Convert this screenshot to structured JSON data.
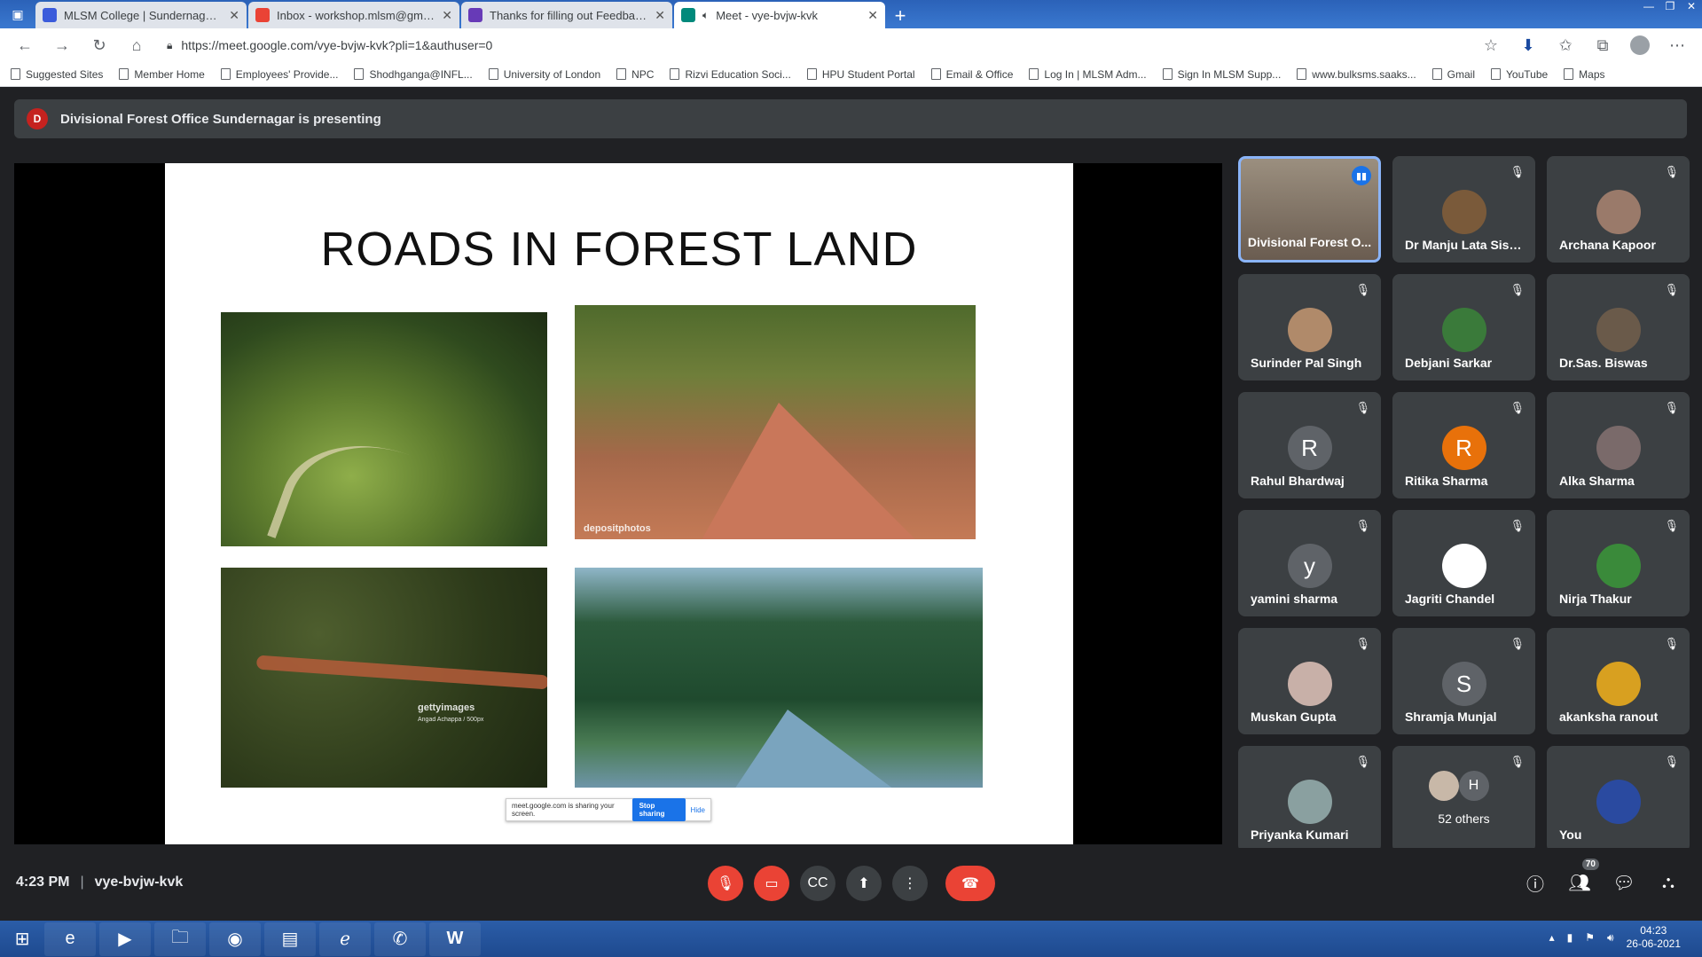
{
  "browser": {
    "tabs": [
      {
        "title": "MLSM College | Sundernagar, M",
        "favicon_color": "#3b5bdb"
      },
      {
        "title": "Inbox - workshop.mlsm@gmail.c",
        "favicon_color": "#ea4335"
      },
      {
        "title": "Thanks for filling out Feedback f",
        "favicon_color": "#673ab7"
      },
      {
        "title": "Meet - vye-bvjw-kvk",
        "favicon_color": "#00897b"
      }
    ],
    "url": "https://meet.google.com/vye-bvjw-kvk?pli=1&authuser=0",
    "bookmarks": [
      "Suggested Sites",
      "Member Home",
      "Employees' Provide...",
      "Shodhganga@INFL...",
      "University of London",
      "NPC",
      "Rizvi Education Soci...",
      "HPU Student Portal",
      "Email & Office",
      "Log In | MLSM Adm...",
      "Sign In MLSM Supp...",
      "www.bulksms.saaks...",
      "Gmail",
      "YouTube",
      "Maps"
    ]
  },
  "meet": {
    "presenting_initial": "D",
    "presenting_text": "Divisional Forest Office Sundernagar is presenting",
    "slide": {
      "title": "ROADS IN FOREST LAND",
      "watermark_deposit": "depositphotos",
      "watermark_getty": "gettyimages",
      "watermark_getty_sub": "Angad Achappa / 500px"
    },
    "share_bar": {
      "text": "meet.google.com is sharing your screen.",
      "stop": "Stop sharing",
      "hide": "Hide"
    },
    "participants": [
      {
        "name": "Divisional Forest O...",
        "initial": "",
        "color": "",
        "speaking": true
      },
      {
        "name": "Dr Manju Lata Siso...",
        "initial": "",
        "color": "#7a5a3a"
      },
      {
        "name": "Archana Kapoor",
        "initial": "",
        "color": "#9a7a6a"
      },
      {
        "name": "Surinder Pal Singh",
        "initial": "",
        "color": "#b08a6a"
      },
      {
        "name": "Debjani Sarkar",
        "initial": "",
        "color": "#3a7a3a"
      },
      {
        "name": "Dr.Sas. Biswas",
        "initial": "",
        "color": "#6a5a4a"
      },
      {
        "name": "Rahul Bhardwaj",
        "initial": "R",
        "color": "#5f6368"
      },
      {
        "name": "Ritika Sharma",
        "initial": "R",
        "color": "#e8710a"
      },
      {
        "name": "Alka Sharma",
        "initial": "",
        "color": "#7a6a6a"
      },
      {
        "name": "yamini sharma",
        "initial": "y",
        "color": "#5f6368"
      },
      {
        "name": "Jagriti Chandel",
        "initial": "",
        "color": "#ffffff"
      },
      {
        "name": "Nirja Thakur",
        "initial": "",
        "color": "#3a8a3a"
      },
      {
        "name": "Muskan Gupta",
        "initial": "",
        "color": "#c8b0a8"
      },
      {
        "name": "Shramja Munjal",
        "initial": "S",
        "color": "#5f6368"
      },
      {
        "name": "akanksha ranout",
        "initial": "",
        "color": "#d8a020"
      },
      {
        "name": "Priyanka Kumari",
        "initial": "",
        "color": "#8aa0a0"
      },
      {
        "name": "52 others",
        "initial": "H",
        "color": "#5f6368",
        "others": true
      },
      {
        "name": "You",
        "initial": "",
        "color": "#2a4aa0"
      }
    ],
    "time": "4:23 PM",
    "meeting_code": "vye-bvjw-kvk",
    "participant_count": "70"
  },
  "taskbar": {
    "time": "04:23",
    "date": "26-06-2021"
  }
}
